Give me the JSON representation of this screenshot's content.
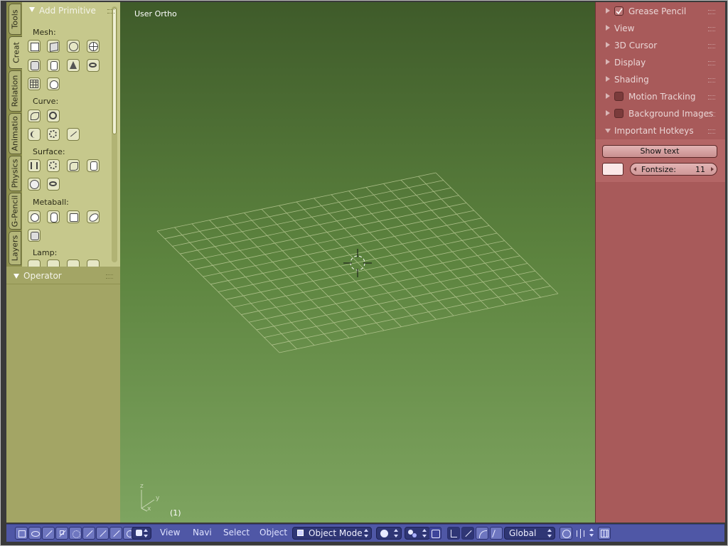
{
  "left_panel": {
    "tabs": [
      "Tools",
      "Creat",
      "Relation",
      "Animatio",
      "Physics",
      "G-Pencil",
      "Layers"
    ],
    "active_tab": "Creat",
    "add_primitive": {
      "title": "Add Primitive",
      "sections": {
        "mesh": "Mesh:",
        "curve": "Curve:",
        "surface": "Surface:",
        "metaball": "Metaball:",
        "lamp": "Lamp:"
      },
      "mesh_icons": [
        "plane-icon",
        "cube-icon",
        "circle-icon",
        "uv-sphere-icon",
        "ico-sphere-icon",
        "cylinder-icon",
        "cone-icon",
        "torus-icon",
        "grid-icon",
        "monkey-icon"
      ],
      "curve_icons": [
        "bezier-icon",
        "curve-circle-icon",
        "nurbs-curve-icon",
        "nurbs-circle-icon",
        "path-icon"
      ],
      "surface_icons": [
        "surface-curve-icon",
        "surface-circle-icon",
        "surface-patch-icon",
        "surface-cylinder-icon",
        "surface-sphere-icon",
        "surface-torus-icon"
      ],
      "metaball_icons": [
        "meta-ball-icon",
        "meta-capsule-icon",
        "meta-plane-icon",
        "meta-ellipsoid-icon",
        "meta-cube-icon"
      ],
      "lamp_icons": [
        "point-lamp-icon",
        "sun-lamp-icon",
        "spot-lamp-icon",
        "hemi-lamp-icon"
      ]
    },
    "operator_title": "Operator"
  },
  "viewport": {
    "view_label": "User Ortho",
    "frame_label": "(1)",
    "axis_labels": {
      "x": "x",
      "y": "y",
      "z": "z"
    }
  },
  "properties": {
    "panels": [
      {
        "label": "Grease Pencil",
        "checkbox": true,
        "checked": true,
        "expanded": false
      },
      {
        "label": "View",
        "checkbox": false,
        "expanded": false
      },
      {
        "label": "3D Cursor",
        "checkbox": false,
        "expanded": false
      },
      {
        "label": "Display",
        "checkbox": false,
        "expanded": false
      },
      {
        "label": "Shading",
        "checkbox": false,
        "expanded": false
      },
      {
        "label": "Motion Tracking",
        "checkbox": true,
        "checked": false,
        "expanded": false
      },
      {
        "label": "Background Images",
        "checkbox": true,
        "checked": false,
        "expanded": false
      },
      {
        "label": "Important Hotkeys",
        "checkbox": false,
        "expanded": true
      }
    ],
    "hotkeys": {
      "show_text_label": "Show text",
      "fontsize_label": "Fontsize:",
      "fontsize_value": "11"
    }
  },
  "header": {
    "menus": [
      "View",
      "Navi",
      "Select",
      "Object"
    ],
    "mode": "Object Mode",
    "transform_orientation": "Global",
    "tool_icons": [
      "transform-icon",
      "view-icon",
      "knife-icon",
      "measure-icon",
      "brush-icon",
      "sculpt-icon",
      "paint-icon",
      "grab-icon",
      "pose-icon"
    ]
  },
  "colors": {
    "shelf_accent": "#c6c88c",
    "properties_accent": "#a85a5a",
    "header_accent": "#4f57a6",
    "viewport_top": "#3f5b2a",
    "viewport_bottom": "#7ea460"
  }
}
